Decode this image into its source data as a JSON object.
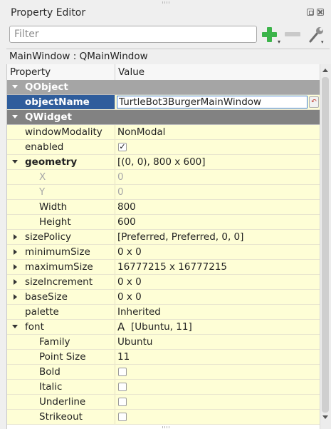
{
  "panel": {
    "title": "Property Editor"
  },
  "filter": {
    "placeholder": "Filter",
    "value": ""
  },
  "class_label": "MainWindow : QMainWindow",
  "columns": {
    "property": "Property",
    "value": "Value"
  },
  "groups": {
    "qobject": "QObject",
    "qwidget": "QWidget"
  },
  "props": {
    "objectName": {
      "label": "objectName",
      "value": "TurtleBot3BurgerMainWindow"
    },
    "windowModality": {
      "label": "windowModality",
      "value": "NonModal"
    },
    "enabled": {
      "label": "enabled",
      "checked": true,
      "mark": "✓"
    },
    "geometry": {
      "label": "geometry",
      "value": "[(0, 0), 800 x 600]"
    },
    "x": {
      "label": "X",
      "value": "0"
    },
    "y": {
      "label": "Y",
      "value": "0"
    },
    "width": {
      "label": "Width",
      "value": "800"
    },
    "height": {
      "label": "Height",
      "value": "600"
    },
    "sizePolicy": {
      "label": "sizePolicy",
      "value": "[Preferred, Preferred, 0, 0]"
    },
    "minimumSize": {
      "label": "minimumSize",
      "value": "0 x 0"
    },
    "maximumSize": {
      "label": "maximumSize",
      "value": "16777215 x 16777215"
    },
    "sizeIncrement": {
      "label": "sizeIncrement",
      "value": "0 x 0"
    },
    "baseSize": {
      "label": "baseSize",
      "value": "0 x 0"
    },
    "palette": {
      "label": "palette",
      "value": "Inherited"
    },
    "font": {
      "label": "font",
      "value": "[Ubuntu, 11]",
      "icon_glyph": "A"
    },
    "family": {
      "label": "Family",
      "value": "Ubuntu"
    },
    "pointSize": {
      "label": "Point Size",
      "value": "11"
    },
    "bold": {
      "label": "Bold",
      "checked": false
    },
    "italic": {
      "label": "Italic",
      "checked": false
    },
    "underline": {
      "label": "Underline",
      "checked": false
    },
    "strikeout": {
      "label": "Strikeout",
      "checked": false
    }
  },
  "colors": {
    "property_row_bg": "#fefed6",
    "group_bg": "#a5a5a5",
    "selection": "#2f5d9c",
    "add_green": "#3cb44a"
  },
  "icons": {
    "add": "plus-icon",
    "remove": "minus-icon",
    "configure": "wrench-icon",
    "float": "float-icon",
    "close": "close-icon",
    "reset": "reset-icon"
  }
}
